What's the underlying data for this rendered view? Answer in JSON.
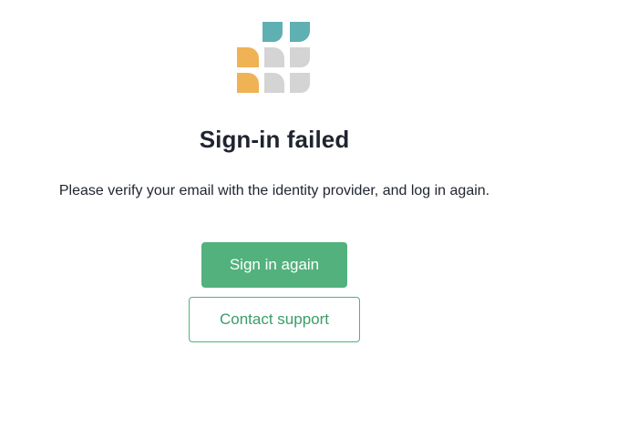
{
  "logo": {
    "icon": "leaf-grid-logo-icon",
    "colors": {
      "teal": "#5fb0b2",
      "orange": "#efb255",
      "gray": "#d4d4d4"
    }
  },
  "title": "Sign-in failed",
  "message": "Please verify your email with the identity provider, and log in again.",
  "buttons": {
    "primary": "Sign in again",
    "secondary": "Contact support"
  },
  "colors": {
    "accent": "#52b17c",
    "text": "#1f2430",
    "background": "#ffffff"
  }
}
